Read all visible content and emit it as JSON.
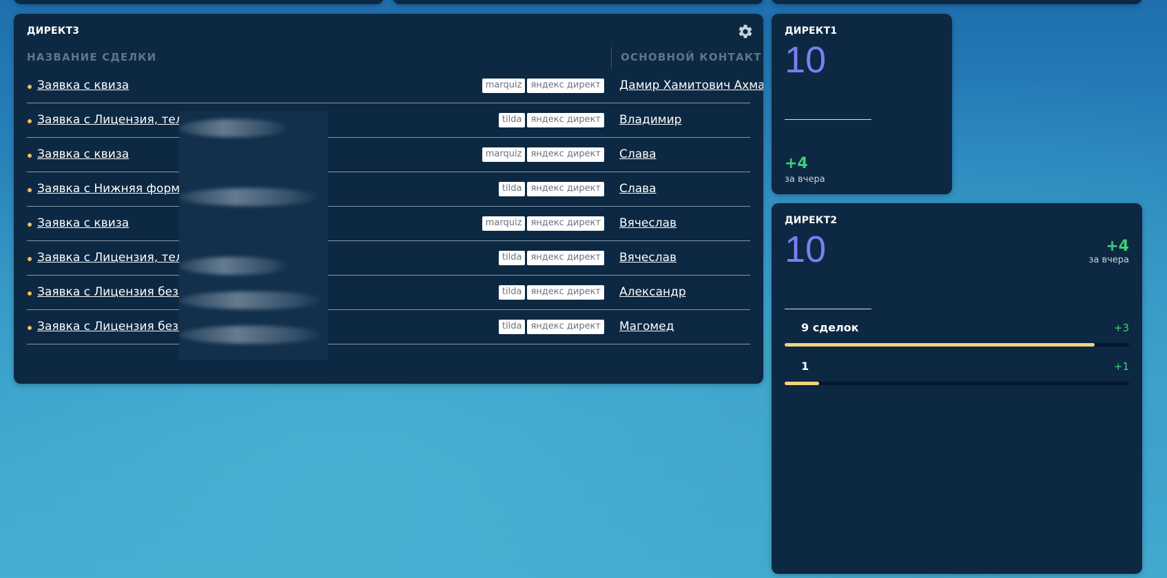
{
  "colors": {
    "card_bg": "#0d2842",
    "accent_number": "#7b7ef2",
    "positive": "#3fd07a",
    "dot": "#f0c05a",
    "bar_fill": "#f5d37e"
  },
  "deals_widget": {
    "title": "ДИРЕКТ3",
    "settings_icon": "gear-icon",
    "columns": {
      "name": "НАЗВАНИЕ СДЕЛКИ",
      "contact": "ОСНОВНОЙ КОНТАКТ"
    },
    "rows": [
      {
        "name": "Заявка с квиза",
        "tags": [
          "marquiz",
          "яндекс директ"
        ],
        "contact": "Дамир Хамитович Ахма"
      },
      {
        "name": "Заявка с Лицензия, тел:+7",
        "tags": [
          "tilda",
          "яндекс директ"
        ],
        "contact": "Владимир"
      },
      {
        "name": "Заявка с квиза",
        "tags": [
          "marquiz",
          "яндекс директ"
        ],
        "contact": "Слава"
      },
      {
        "name": "Заявка с Нижняя форма, т",
        "tags": [
          "tilda",
          "яндекс директ"
        ],
        "contact": "Слава"
      },
      {
        "name": "Заявка с квиза",
        "tags": [
          "marquiz",
          "яндекс директ"
        ],
        "contact": "Вячеслав"
      },
      {
        "name": "Заявка с Лицензия, тел:+7",
        "tags": [
          "tilda",
          "яндекс директ"
        ],
        "contact": "Вячеслав"
      },
      {
        "name": "Заявка с Лицензия без И",
        "tags": [
          "tilda",
          "яндекс директ"
        ],
        "contact": "Александр"
      },
      {
        "name": "Заявка с Лицензия без И",
        "tags": [
          "tilda",
          "яндекс директ"
        ],
        "contact": "Магомед"
      }
    ]
  },
  "direct1": {
    "title": "ДИРЕКТ1",
    "value": "10",
    "delta": "+4",
    "delta_label": "за вчера"
  },
  "direct2": {
    "title": "ДИРЕКТ2",
    "value": "10",
    "delta": "+4",
    "delta_label": "за вчера",
    "bars": [
      {
        "label": "9 сделок",
        "increment": "+3",
        "fraction": 0.9
      },
      {
        "label": "1",
        "increment": "+1",
        "fraction": 0.1
      }
    ]
  }
}
